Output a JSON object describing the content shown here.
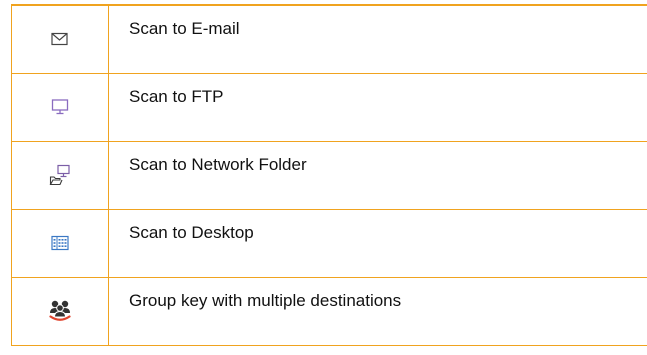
{
  "destinations": [
    {
      "icon": "envelope-icon",
      "label": "Scan to E-mail"
    },
    {
      "icon": "monitor-icon",
      "label": "Scan to FTP"
    },
    {
      "icon": "network-folder-icon",
      "label": "Scan to Network Folder"
    },
    {
      "icon": "desktop-grid-icon",
      "label": "Scan to Desktop"
    },
    {
      "icon": "group-users-icon",
      "label": "Group key with multiple destinations"
    }
  ],
  "colors": {
    "border": "#f0a31f",
    "icon_purple": "#7b5ea7",
    "icon_blue": "#3b78c4",
    "icon_red": "#e0452f",
    "icon_dark": "#3a3a3a"
  }
}
